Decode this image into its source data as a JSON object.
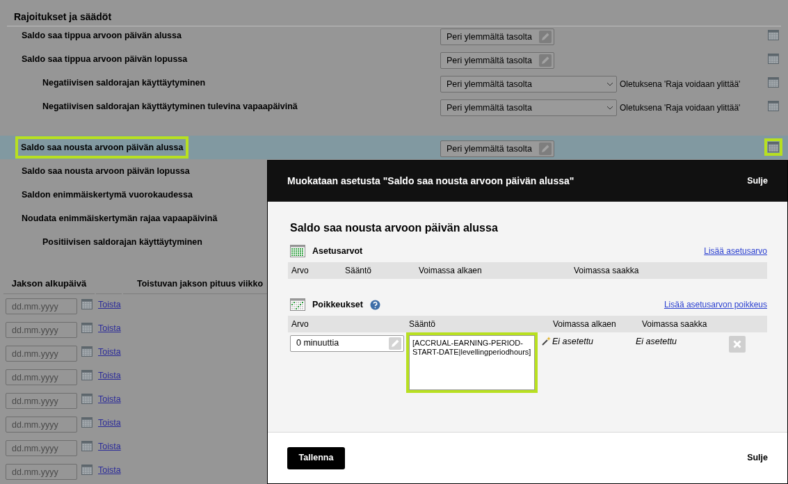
{
  "page": {
    "section_title": "Rajoitukset ja säädöt",
    "setting_groups": [
      [
        {
          "label": "Saldo saa tippua arvoon päivän alussa",
          "highlighted": false,
          "selected": false,
          "control": {
            "kind": "edit",
            "value": "Peri ylemmältä tasolta"
          }
        },
        {
          "label": "Saldo saa tippua arvoon päivän lopussa",
          "highlighted": false,
          "selected": false,
          "control": {
            "kind": "edit",
            "value": "Peri ylemmältä tasolta"
          },
          "children": [
            {
              "label": "Negatiivisen saldorajan käyttäytyminen",
              "highlighted": false,
              "selected": false,
              "control": {
                "kind": "select",
                "value": "Peri ylemmältä tasolta",
                "note": "Oletuksena 'Raja voidaan ylittää'"
              }
            },
            {
              "label": "Negatiivisen saldorajan käyttäytyminen tulevina vapaapäivinä",
              "highlighted": false,
              "selected": false,
              "control": {
                "kind": "select",
                "value": "Peri ylemmältä tasolta",
                "note": "Oletuksena 'Raja voidaan ylittää'"
              }
            }
          ]
        }
      ],
      [
        {
          "label": "Saldo saa nousta arvoon päivän alussa",
          "highlighted": true,
          "selected": true,
          "control": {
            "kind": "edit",
            "value": "Peri ylemmältä tasolta"
          }
        },
        {
          "label": "Saldo saa nousta arvoon päivän lopussa",
          "highlighted": false,
          "selected": false
        },
        {
          "label": "Saldon enimmäiskertymä vuorokaudessa",
          "highlighted": false,
          "selected": false
        },
        {
          "label": "Noudata enimmäiskertymän rajaa vapaapäivinä",
          "highlighted": false,
          "selected": false,
          "children": [
            {
              "label": "Positiivisen saldorajan käyttäytyminen",
              "highlighted": false,
              "selected": false
            }
          ]
        }
      ]
    ],
    "period_table": {
      "columns": [
        "Jakson alkupäivä",
        "Toistuvan jakson pituus viikko"
      ],
      "rows": [
        {
          "placeholder": "dd.mm.yyyy",
          "link": "Toista"
        },
        {
          "placeholder": "dd.mm.yyyy",
          "link": "Toista"
        },
        {
          "placeholder": "dd.mm.yyyy",
          "link": "Toista"
        },
        {
          "placeholder": "dd.mm.yyyy",
          "link": "Toista"
        },
        {
          "placeholder": "dd.mm.yyyy",
          "link": "Toista"
        },
        {
          "placeholder": "dd.mm.yyyy",
          "link": "Toista"
        },
        {
          "placeholder": "dd.mm.yyyy",
          "link": "Toista"
        },
        {
          "placeholder": "dd.mm.yyyy",
          "link": "Toista"
        }
      ]
    }
  },
  "dialog": {
    "title": "Muokataan asetusta \"Saldo saa nousta arvoon päivän alussa\"",
    "close": "Sulje",
    "heading": "Saldo saa nousta arvoon päivän alussa",
    "values_section": {
      "title": "Asetusarvot",
      "link": "Lisää asetusarvo",
      "columns": [
        "Arvo",
        "Sääntö",
        "Voimassa alkaen",
        "Voimassa saakka"
      ]
    },
    "exceptions_section": {
      "title": "Poikkeukset",
      "link": "Lisää asetusarvon poikkeus",
      "columns": [
        "Arvo",
        "Sääntö",
        "Voimassa alkaen",
        "Voimassa saakka"
      ],
      "rows": [
        {
          "value": "0 minuuttia",
          "rule": "[ACCRUAL-EARNING-PERIOD-START-DATE|levellingperiodhours]",
          "rule_highlighted": true,
          "from": "Ei asetettu",
          "to": "Ei asetettu"
        }
      ]
    },
    "save": "Tallenna",
    "footer_close": "Sulje"
  }
}
